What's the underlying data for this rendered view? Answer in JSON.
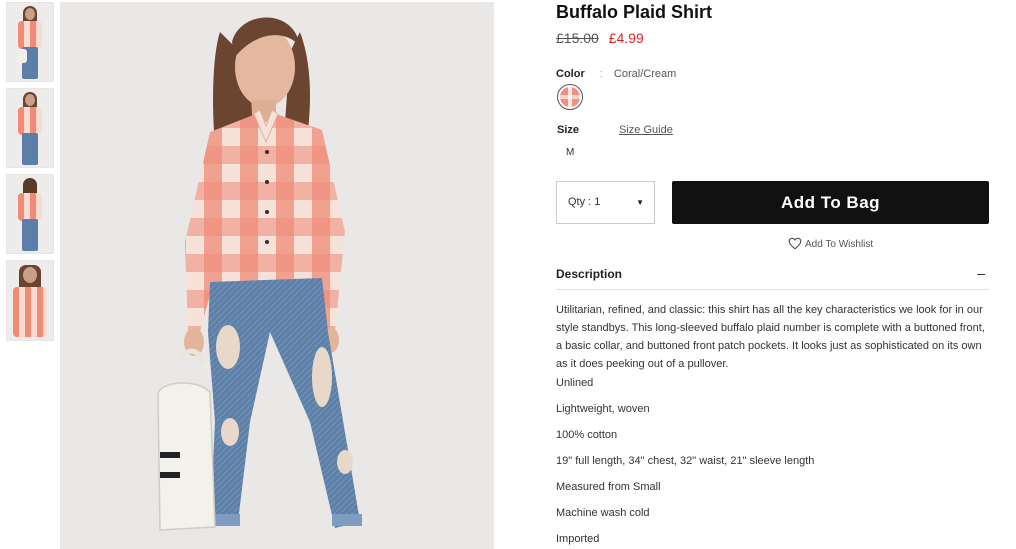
{
  "product": {
    "title": "Buffalo Plaid Shirt",
    "old_price": "£15.00",
    "new_price": "£4.99"
  },
  "color": {
    "label": "Color",
    "separator": ":",
    "value": "Coral/Cream"
  },
  "size": {
    "label": "Size",
    "guide_link": "Size Guide",
    "selected": "M"
  },
  "qty": {
    "label": "Qty : 1"
  },
  "actions": {
    "add_to_bag": "Add To Bag",
    "wishlist": "Add To Wishlist"
  },
  "description": {
    "heading": "Description",
    "toggle": "–",
    "text": "Utilitarian, refined, and classic: this shirt has all the key characteristics we look for in our style standbys. This long-sleeved buffalo plaid number is complete with a buttoned front, a basic collar, and buttoned front patch pockets. It looks just as sophisticated on its own as it does peeking out of a pullover.",
    "details": [
      "Unlined",
      "Lightweight, woven",
      "100% cotton",
      "19\" full length, 34\" chest, 32\" waist, 21\" sleeve length",
      "Measured from Small",
      "Machine wash cold",
      "Imported"
    ]
  },
  "colors": {
    "price_sale": "#d8262c",
    "button_bg": "#111111",
    "plaid_coral": "#ef8a78",
    "plaid_cream": "#f6e2d8",
    "denim": "#5b7fa8"
  },
  "icons": [
    "heart-outline-icon",
    "caret-down-icon",
    "collapse-minus-icon"
  ]
}
